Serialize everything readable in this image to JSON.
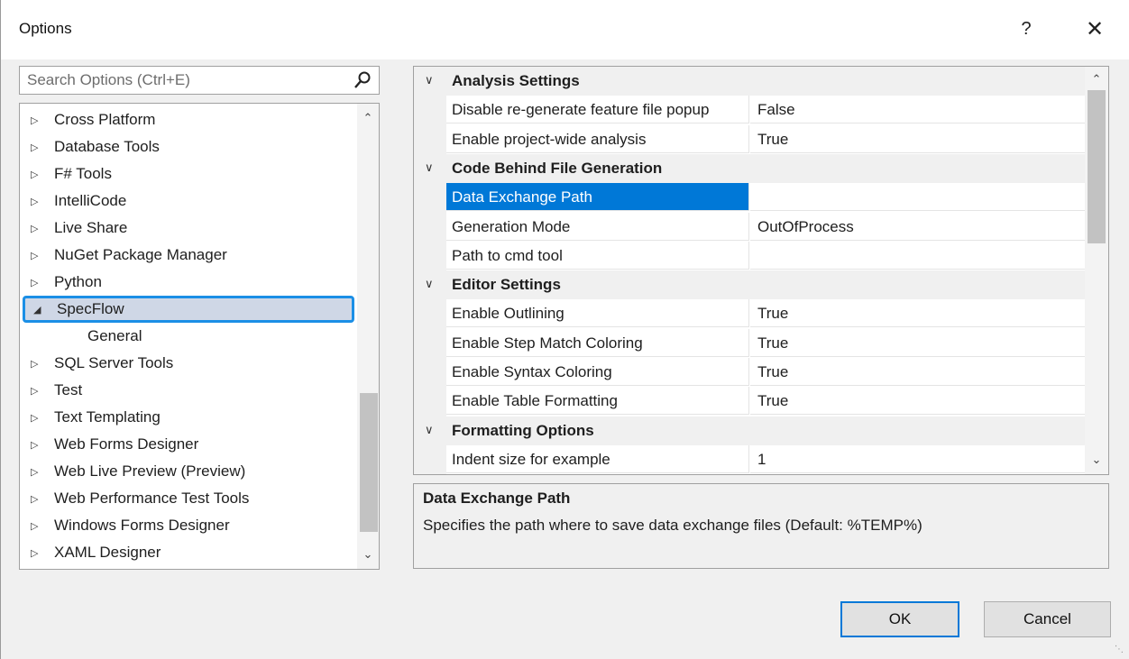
{
  "window": {
    "title": "Options",
    "help_glyph": "?",
    "close_glyph": "✕"
  },
  "search": {
    "placeholder": "Search Options (Ctrl+E)"
  },
  "tree": {
    "items": [
      {
        "label": "Cross Platform",
        "expanded": false
      },
      {
        "label": "Database Tools",
        "expanded": false
      },
      {
        "label": "F# Tools",
        "expanded": false
      },
      {
        "label": "IntelliCode",
        "expanded": false
      },
      {
        "label": "Live Share",
        "expanded": false
      },
      {
        "label": "NuGet Package Manager",
        "expanded": false
      },
      {
        "label": "Python",
        "expanded": false
      },
      {
        "label": "SpecFlow",
        "expanded": true,
        "selected": true
      },
      {
        "label": "General",
        "child": true
      },
      {
        "label": "SQL Server Tools",
        "expanded": false
      },
      {
        "label": "Test",
        "expanded": false
      },
      {
        "label": "Text Templating",
        "expanded": false
      },
      {
        "label": "Web Forms Designer",
        "expanded": false
      },
      {
        "label": "Web Live Preview (Preview)",
        "expanded": false
      },
      {
        "label": "Web Performance Test Tools",
        "expanded": false
      },
      {
        "label": "Windows Forms Designer",
        "expanded": false
      },
      {
        "label": "XAML Designer",
        "expanded": false
      }
    ]
  },
  "grid": {
    "rows": [
      {
        "type": "category",
        "label": "Analysis Settings"
      },
      {
        "type": "prop",
        "name": "Disable re-generate feature file popup",
        "value": "False"
      },
      {
        "type": "prop",
        "name": "Enable project-wide analysis",
        "value": "True"
      },
      {
        "type": "category",
        "label": "Code Behind File Generation"
      },
      {
        "type": "prop",
        "name": "Data Exchange Path",
        "value": "",
        "selected": true
      },
      {
        "type": "prop",
        "name": "Generation Mode",
        "value": "OutOfProcess"
      },
      {
        "type": "prop",
        "name": "Path to cmd tool",
        "value": ""
      },
      {
        "type": "category",
        "label": "Editor Settings"
      },
      {
        "type": "prop",
        "name": "Enable Outlining",
        "value": "True"
      },
      {
        "type": "prop",
        "name": "Enable Step Match Coloring",
        "value": "True"
      },
      {
        "type": "prop",
        "name": "Enable Syntax Coloring",
        "value": "True"
      },
      {
        "type": "prop",
        "name": "Enable Table Formatting",
        "value": "True"
      },
      {
        "type": "category",
        "label": "Formatting Options"
      },
      {
        "type": "prop",
        "name": "Indent size for example",
        "value": "1"
      }
    ]
  },
  "description": {
    "title": "Data Exchange Path",
    "text": "Specifies the path where to save data exchange files (Default: %TEMP%)"
  },
  "buttons": {
    "ok": "OK",
    "cancel": "Cancel"
  },
  "colors": {
    "accent": "#0078d7",
    "tree_selection_border": "#1b8fe6",
    "tree_selection_fill": "#cfd7e6"
  }
}
